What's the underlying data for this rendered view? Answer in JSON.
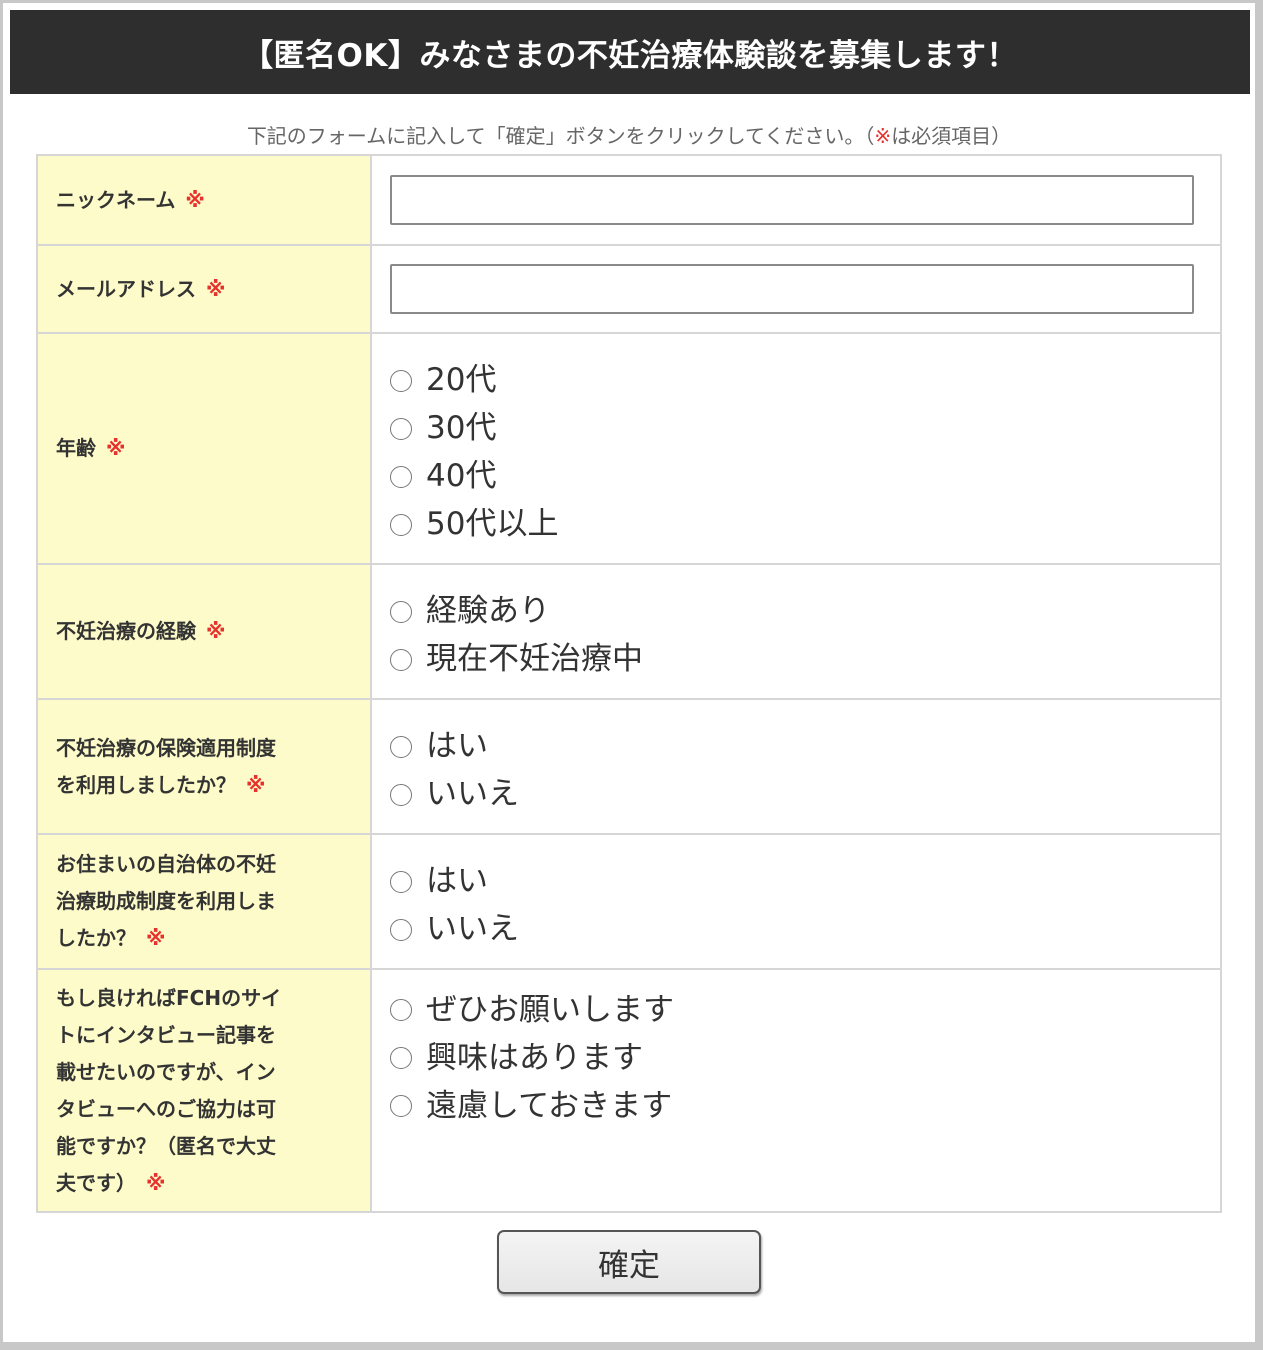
{
  "header": {
    "title": "【匿名OK】みなさまの不妊治療体験談を募集します！"
  },
  "instruction": {
    "prefix": "下記のフォームに記入して「確定」ボタンをクリックしてください。（",
    "mark": "※",
    "suffix": "は必須項目）"
  },
  "required_mark": "※",
  "fields": {
    "nickname": {
      "label": "ニックネーム",
      "value": ""
    },
    "email": {
      "label": "メールアドレス",
      "value": ""
    },
    "age": {
      "label": "年齢",
      "options": [
        "20代",
        "30代",
        "40代",
        "50代以上"
      ]
    },
    "experience": {
      "label": "不妊治療の経験",
      "options": [
        "経験あり",
        "現在不妊治療中"
      ]
    },
    "insurance": {
      "label_lines": [
        "不妊治療の保険適用制度",
        "を利用しましたか？"
      ],
      "options": [
        "はい",
        "いいえ"
      ]
    },
    "subsidy": {
      "label_lines": [
        "お住まいの自治体の不妊",
        "治療助成制度を利用しま",
        "したか？"
      ],
      "options": [
        "はい",
        "いいえ"
      ]
    },
    "interview": {
      "label_lines": [
        "もし良ければFCHのサイ",
        "トにインタビュー記事を",
        "載せたいのですが、イン",
        "タビューへのご協力は可",
        "能ですか？（匿名で大丈",
        "夫です）"
      ],
      "options": [
        "ぜひお願いします",
        "興味はあります",
        "遠慮しておきます"
      ]
    }
  },
  "submit": {
    "label": "確定"
  },
  "colors": {
    "header_bg": "#2e2e2e",
    "label_bg": "#fdfbc9",
    "required": "#e6322d",
    "border": "#d6d6d6"
  }
}
